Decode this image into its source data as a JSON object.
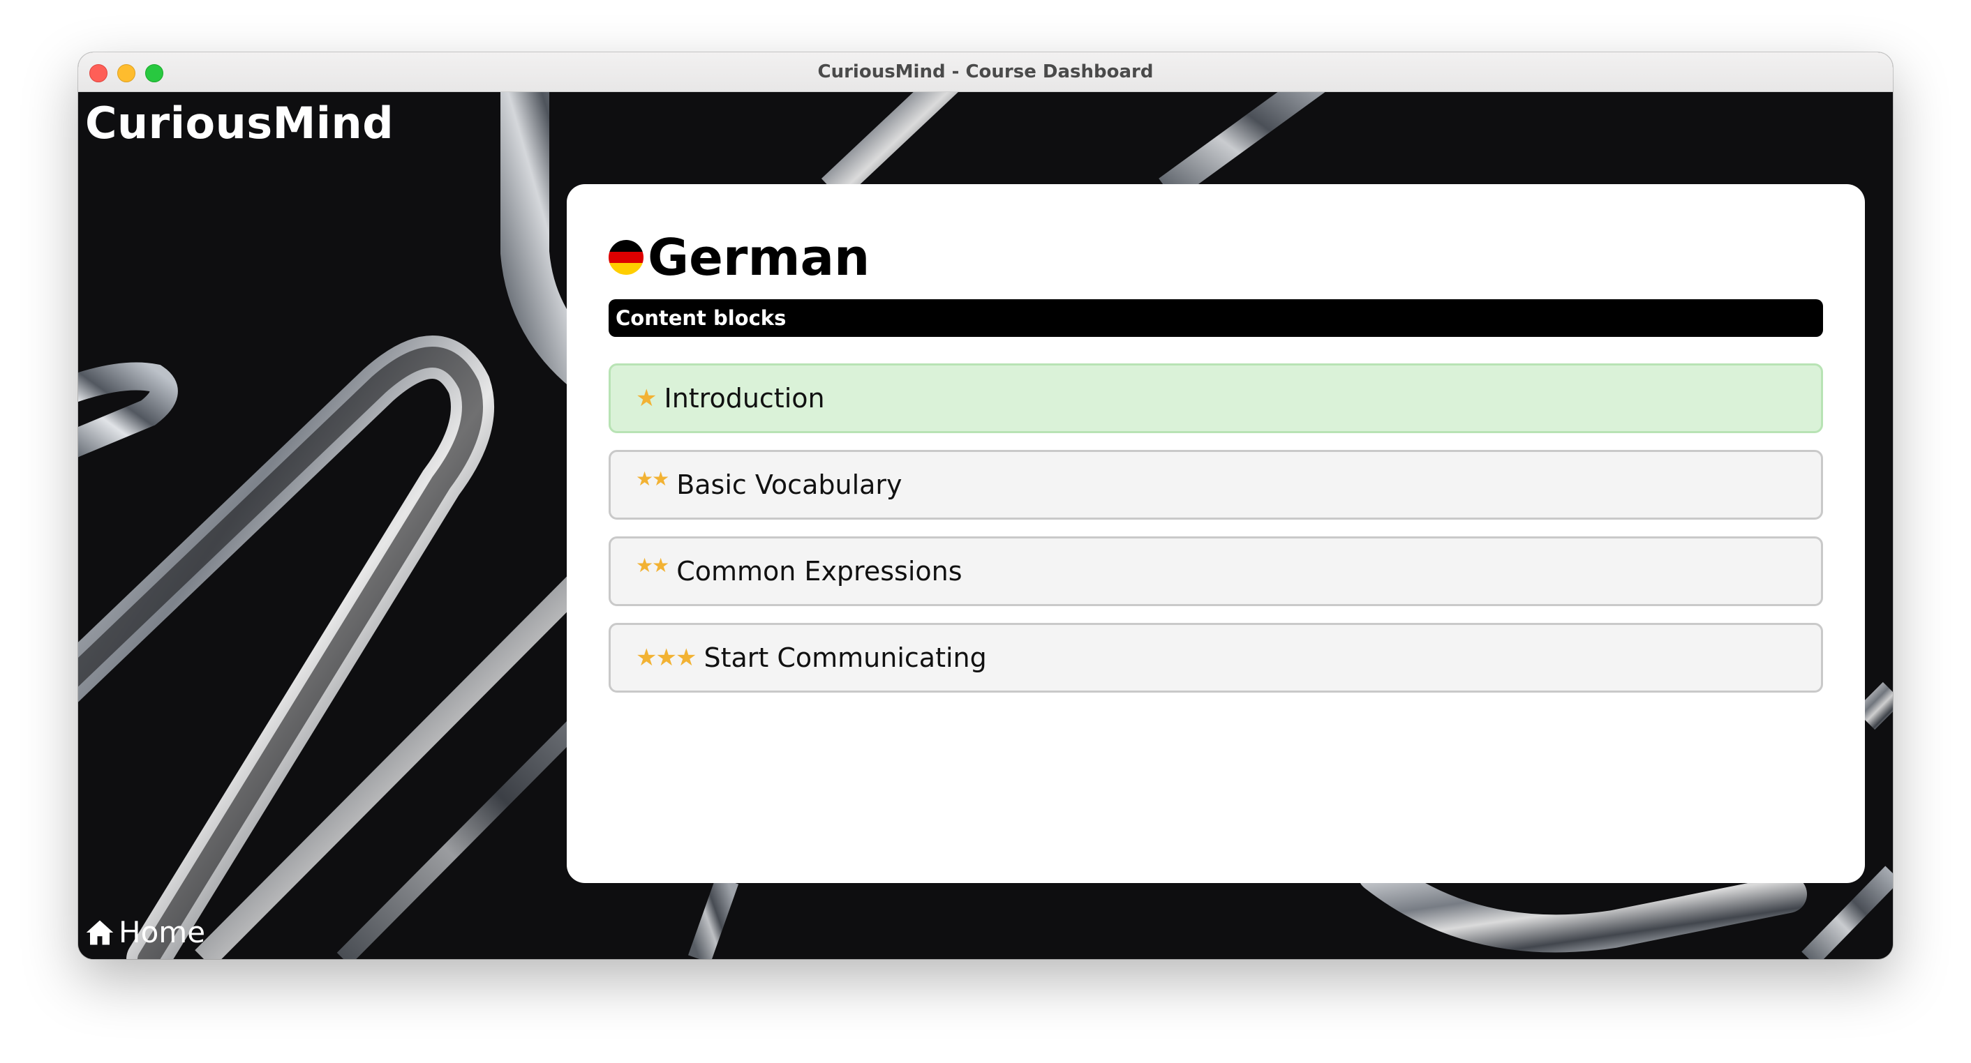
{
  "window": {
    "title": "CuriousMind - Course Dashboard"
  },
  "app": {
    "brand": "CuriousMind",
    "home_label": "Home"
  },
  "course": {
    "title": "German",
    "flag_colors": [
      "#000000",
      "#dd0000",
      "#ffce00"
    ],
    "section_label": "Content blocks",
    "blocks": [
      {
        "label": "Introduction",
        "stars": "★",
        "difficulty": 1,
        "active": true
      },
      {
        "label": "Basic Vocabulary",
        "stars": "★★",
        "difficulty": 2,
        "active": false
      },
      {
        "label": "Common Expressions",
        "stars": "★★",
        "difficulty": 2,
        "active": false
      },
      {
        "label": "Start Communicating",
        "stars": "★★★",
        "difficulty": 3,
        "active": false
      }
    ]
  },
  "colors": {
    "active_block_bg": "#daf2d8",
    "block_bg": "#f4f4f4",
    "star": "#f2b233",
    "section_bar": "#000000"
  }
}
